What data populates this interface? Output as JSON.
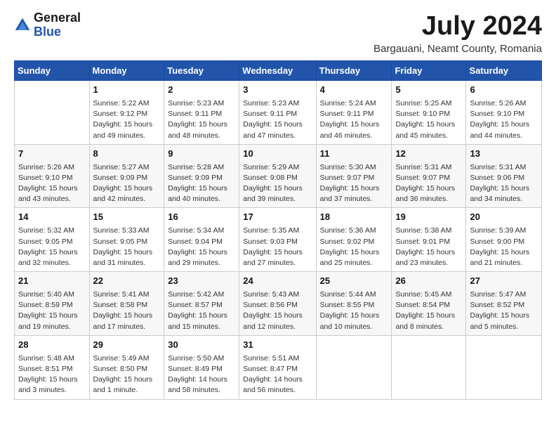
{
  "logo": {
    "general": "General",
    "blue": "Blue"
  },
  "title": "July 2024",
  "location": "Bargauani, Neamt County, Romania",
  "headers": [
    "Sunday",
    "Monday",
    "Tuesday",
    "Wednesday",
    "Thursday",
    "Friday",
    "Saturday"
  ],
  "weeks": [
    [
      {
        "day": "",
        "sunrise": "",
        "sunset": "",
        "daylight": ""
      },
      {
        "day": "1",
        "sunrise": "Sunrise: 5:22 AM",
        "sunset": "Sunset: 9:12 PM",
        "daylight": "Daylight: 15 hours and 49 minutes."
      },
      {
        "day": "2",
        "sunrise": "Sunrise: 5:23 AM",
        "sunset": "Sunset: 9:11 PM",
        "daylight": "Daylight: 15 hours and 48 minutes."
      },
      {
        "day": "3",
        "sunrise": "Sunrise: 5:23 AM",
        "sunset": "Sunset: 9:11 PM",
        "daylight": "Daylight: 15 hours and 47 minutes."
      },
      {
        "day": "4",
        "sunrise": "Sunrise: 5:24 AM",
        "sunset": "Sunset: 9:11 PM",
        "daylight": "Daylight: 15 hours and 46 minutes."
      },
      {
        "day": "5",
        "sunrise": "Sunrise: 5:25 AM",
        "sunset": "Sunset: 9:10 PM",
        "daylight": "Daylight: 15 hours and 45 minutes."
      },
      {
        "day": "6",
        "sunrise": "Sunrise: 5:26 AM",
        "sunset": "Sunset: 9:10 PM",
        "daylight": "Daylight: 15 hours and 44 minutes."
      }
    ],
    [
      {
        "day": "7",
        "sunrise": "Sunrise: 5:26 AM",
        "sunset": "Sunset: 9:10 PM",
        "daylight": "Daylight: 15 hours and 43 minutes."
      },
      {
        "day": "8",
        "sunrise": "Sunrise: 5:27 AM",
        "sunset": "Sunset: 9:09 PM",
        "daylight": "Daylight: 15 hours and 42 minutes."
      },
      {
        "day": "9",
        "sunrise": "Sunrise: 5:28 AM",
        "sunset": "Sunset: 9:09 PM",
        "daylight": "Daylight: 15 hours and 40 minutes."
      },
      {
        "day": "10",
        "sunrise": "Sunrise: 5:29 AM",
        "sunset": "Sunset: 9:08 PM",
        "daylight": "Daylight: 15 hours and 39 minutes."
      },
      {
        "day": "11",
        "sunrise": "Sunrise: 5:30 AM",
        "sunset": "Sunset: 9:07 PM",
        "daylight": "Daylight: 15 hours and 37 minutes."
      },
      {
        "day": "12",
        "sunrise": "Sunrise: 5:31 AM",
        "sunset": "Sunset: 9:07 PM",
        "daylight": "Daylight: 15 hours and 36 minutes."
      },
      {
        "day": "13",
        "sunrise": "Sunrise: 5:31 AM",
        "sunset": "Sunset: 9:06 PM",
        "daylight": "Daylight: 15 hours and 34 minutes."
      }
    ],
    [
      {
        "day": "14",
        "sunrise": "Sunrise: 5:32 AM",
        "sunset": "Sunset: 9:05 PM",
        "daylight": "Daylight: 15 hours and 32 minutes."
      },
      {
        "day": "15",
        "sunrise": "Sunrise: 5:33 AM",
        "sunset": "Sunset: 9:05 PM",
        "daylight": "Daylight: 15 hours and 31 minutes."
      },
      {
        "day": "16",
        "sunrise": "Sunrise: 5:34 AM",
        "sunset": "Sunset: 9:04 PM",
        "daylight": "Daylight: 15 hours and 29 minutes."
      },
      {
        "day": "17",
        "sunrise": "Sunrise: 5:35 AM",
        "sunset": "Sunset: 9:03 PM",
        "daylight": "Daylight: 15 hours and 27 minutes."
      },
      {
        "day": "18",
        "sunrise": "Sunrise: 5:36 AM",
        "sunset": "Sunset: 9:02 PM",
        "daylight": "Daylight: 15 hours and 25 minutes."
      },
      {
        "day": "19",
        "sunrise": "Sunrise: 5:38 AM",
        "sunset": "Sunset: 9:01 PM",
        "daylight": "Daylight: 15 hours and 23 minutes."
      },
      {
        "day": "20",
        "sunrise": "Sunrise: 5:39 AM",
        "sunset": "Sunset: 9:00 PM",
        "daylight": "Daylight: 15 hours and 21 minutes."
      }
    ],
    [
      {
        "day": "21",
        "sunrise": "Sunrise: 5:40 AM",
        "sunset": "Sunset: 8:59 PM",
        "daylight": "Daylight: 15 hours and 19 minutes."
      },
      {
        "day": "22",
        "sunrise": "Sunrise: 5:41 AM",
        "sunset": "Sunset: 8:58 PM",
        "daylight": "Daylight: 15 hours and 17 minutes."
      },
      {
        "day": "23",
        "sunrise": "Sunrise: 5:42 AM",
        "sunset": "Sunset: 8:57 PM",
        "daylight": "Daylight: 15 hours and 15 minutes."
      },
      {
        "day": "24",
        "sunrise": "Sunrise: 5:43 AM",
        "sunset": "Sunset: 8:56 PM",
        "daylight": "Daylight: 15 hours and 12 minutes."
      },
      {
        "day": "25",
        "sunrise": "Sunrise: 5:44 AM",
        "sunset": "Sunset: 8:55 PM",
        "daylight": "Daylight: 15 hours and 10 minutes."
      },
      {
        "day": "26",
        "sunrise": "Sunrise: 5:45 AM",
        "sunset": "Sunset: 8:54 PM",
        "daylight": "Daylight: 15 hours and 8 minutes."
      },
      {
        "day": "27",
        "sunrise": "Sunrise: 5:47 AM",
        "sunset": "Sunset: 8:52 PM",
        "daylight": "Daylight: 15 hours and 5 minutes."
      }
    ],
    [
      {
        "day": "28",
        "sunrise": "Sunrise: 5:48 AM",
        "sunset": "Sunset: 8:51 PM",
        "daylight": "Daylight: 15 hours and 3 minutes."
      },
      {
        "day": "29",
        "sunrise": "Sunrise: 5:49 AM",
        "sunset": "Sunset: 8:50 PM",
        "daylight": "Daylight: 15 hours and 1 minute."
      },
      {
        "day": "30",
        "sunrise": "Sunrise: 5:50 AM",
        "sunset": "Sunset: 8:49 PM",
        "daylight": "Daylight: 14 hours and 58 minutes."
      },
      {
        "day": "31",
        "sunrise": "Sunrise: 5:51 AM",
        "sunset": "Sunset: 8:47 PM",
        "daylight": "Daylight: 14 hours and 56 minutes."
      },
      {
        "day": "",
        "sunrise": "",
        "sunset": "",
        "daylight": ""
      },
      {
        "day": "",
        "sunrise": "",
        "sunset": "",
        "daylight": ""
      },
      {
        "day": "",
        "sunrise": "",
        "sunset": "",
        "daylight": ""
      }
    ]
  ]
}
